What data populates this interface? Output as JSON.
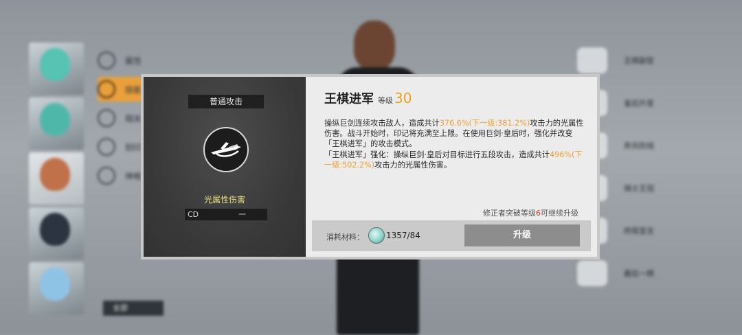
{
  "background": {
    "menu_items": [
      "属性",
      "技能",
      "相关",
      "刻印",
      "神格"
    ],
    "all_label": "全部",
    "equip_items": [
      "王棋副官",
      "皇后升变",
      "弃兵防线",
      "骑士王冠",
      "终局宣言",
      "最后一棋"
    ]
  },
  "modal": {
    "skill_type": "普通攻击",
    "element": "光属性伤害",
    "cd_label": "CD",
    "cd_value": "一",
    "skill_name": "王棋进军",
    "level_label": "等级",
    "level": "30",
    "desc": {
      "p1_a": "操纵巨剑连续攻击敌人，造成共计",
      "p1_hl": "376.6%(下一级:381.2%)",
      "p1_b": "攻击力的光属性伤害。战斗开始时，印记将充满至上限。在使用巨剑·皇后时，强化并改变「王棋进军」的攻击模式。",
      "p2_a": "「王棋进军」强化：操纵巨剑·皇后对目标进行五段攻击，造成共计",
      "p2_hl": "496%(下一级:502.2%)",
      "p2_b": "攻击力的光属性伤害。"
    },
    "note_a": "修正者突破等级",
    "note_num": "6",
    "note_b": "可继续升级",
    "cost_label": "消耗材料：",
    "cost_count": "1357/84",
    "upgrade_label": "升级"
  },
  "colors": {
    "accent_orange": "#f29c1f",
    "element_yellow": "#e6df7d",
    "warning_red": "#d8352a"
  }
}
